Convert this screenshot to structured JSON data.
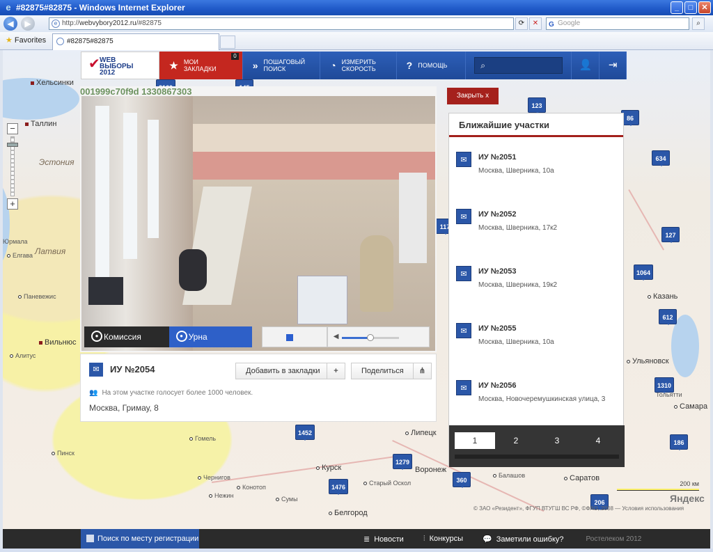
{
  "window": {
    "title": "#82875#82875 - Windows Internet Explorer",
    "min": "_",
    "max": "□",
    "close": "✕"
  },
  "addressbar": {
    "url_prefix": "http://",
    "url_host": "webvybory2012.ru",
    "url_path": "/#82875",
    "search_placeholder": "Google"
  },
  "favorites": {
    "label": "Favorites",
    "tab_title": "#82875#82875"
  },
  "nav": {
    "logo_line1": "WEB",
    "logo_line2": "ВЫБОРЫ",
    "logo_line3": "2012",
    "bookmarks_line1": "Мои",
    "bookmarks_line2": "закладки",
    "bookmarks_count": "0",
    "stepsearch_line1": "Пошаговый",
    "stepsearch_line2": "поиск",
    "speed_line1": "Измерить",
    "speed_line2": "скорость",
    "help": "Помощь"
  },
  "video": {
    "caption": "001999c70f9d 1330867303",
    "btn_commission": "Комиссия",
    "btn_urn": "Урна",
    "volume": 0.5
  },
  "station": {
    "title": "ИУ №2054",
    "add_bookmark": "Добавить в закладки",
    "share": "Поделиться",
    "note": "На этом участке голосует более 1000 человек.",
    "address": "Москва, Гримау, 8"
  },
  "close_label": "Закрыть x",
  "nearest": {
    "heading": "Ближайшие участки",
    "items": [
      {
        "title": "ИУ №2051",
        "address": "Москва, Шверника, 10а"
      },
      {
        "title": "ИУ №2052",
        "address": "Москва, Шверника, 17к2"
      },
      {
        "title": "ИУ №2053",
        "address": "Москва, Шверника, 19к2"
      },
      {
        "title": "ИУ №2055",
        "address": "Москва, Шверника, 10а"
      },
      {
        "title": "ИУ №2056",
        "address": "Москва, Новочеремушкинская улица, 3"
      }
    ],
    "pages": [
      "1",
      "2",
      "3",
      "4"
    ]
  },
  "map": {
    "scale": "200 км",
    "yandex": "Яндекс",
    "copyright": "© ЗАО «Резидент», ФГУП ВТУГШ ВС РФ, ©ФАО, 2008 — Условия использования",
    "markers": [
      "2160",
      "145",
      "123",
      "86",
      "634",
      "117",
      "127",
      "1064",
      "612",
      "1310",
      "186",
      "1452",
      "1279",
      "1476",
      "360",
      "206"
    ],
    "cities": [
      "Хельсинки",
      "Таллин",
      "Эстония",
      "Латвия",
      "Вильнюс",
      "Елгава",
      "Паневежис",
      "Алитус",
      "Юрмала",
      "Казань",
      "Самара",
      "Ульяновск",
      "Саратов",
      "Курск",
      "Белгород",
      "Воронеж",
      "Липецк",
      "Гомель",
      "Пинск",
      "Чернигов",
      "Конотоп",
      "Сумы",
      "Старый Оскол",
      "Балашов",
      "Тольятти",
      "Нежин"
    ]
  },
  "bottom": {
    "register_search": "Поиск по месту регистрации",
    "news": "Новости",
    "contests": "Конкурсы",
    "report_error": "Заметили ошибку?",
    "rostelecom": "Ростелеком 2012"
  }
}
